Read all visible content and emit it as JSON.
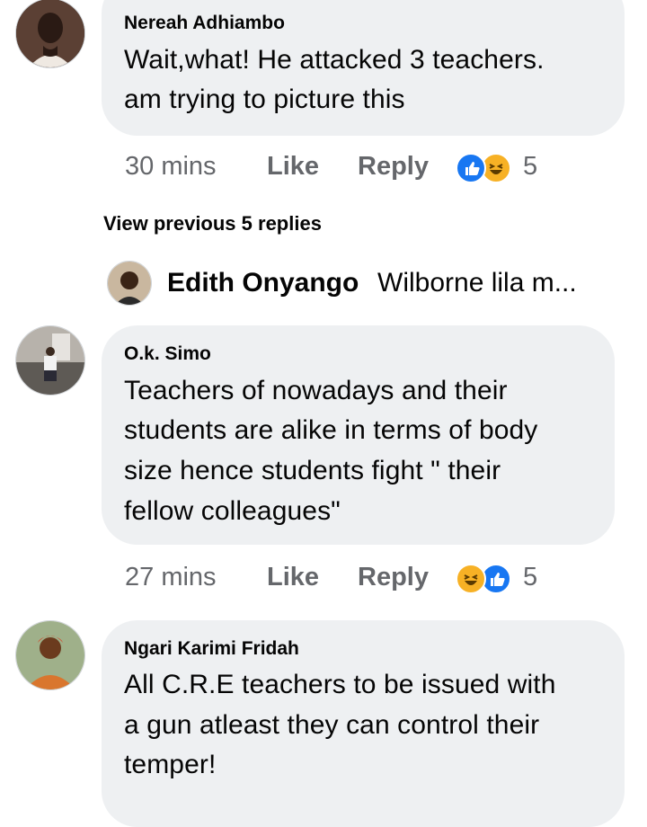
{
  "comments": [
    {
      "author": "Nereah Adhiambo",
      "lines": [
        "Wait,what! He attacked  3 teachers.",
        "am trying to picture this"
      ],
      "time": "30 mins",
      "like_label": "Like",
      "reply_label": "Reply",
      "reaction_icons": [
        "like-icon",
        "haha-icon"
      ],
      "reaction_count": "5"
    },
    {
      "author": "O.k. Simo",
      "lines": [
        "Teachers of nowadays and their",
        "students are alike in terms of body",
        "size hence students fight \" their",
        "fellow colleagues\""
      ],
      "time": "27 mins",
      "like_label": "Like",
      "reply_label": "Reply",
      "reaction_icons": [
        "haha-icon",
        "like-icon"
      ],
      "reaction_count": "5"
    },
    {
      "author": "Ngari Karimi Fridah",
      "lines": [
        "All C.R.E teachers to be issued with",
        "a gun atleast they can control their",
        "temper!"
      ]
    }
  ],
  "view_previous": "View previous 5 replies",
  "reply_preview": {
    "author": "Edith Onyango",
    "text": "Wilborne lila m..."
  },
  "colors": {
    "bubble": "#eef0f2",
    "meta_text": "#65676b",
    "like_blue": "#1877f2",
    "haha_yellow": "#f7b125"
  }
}
